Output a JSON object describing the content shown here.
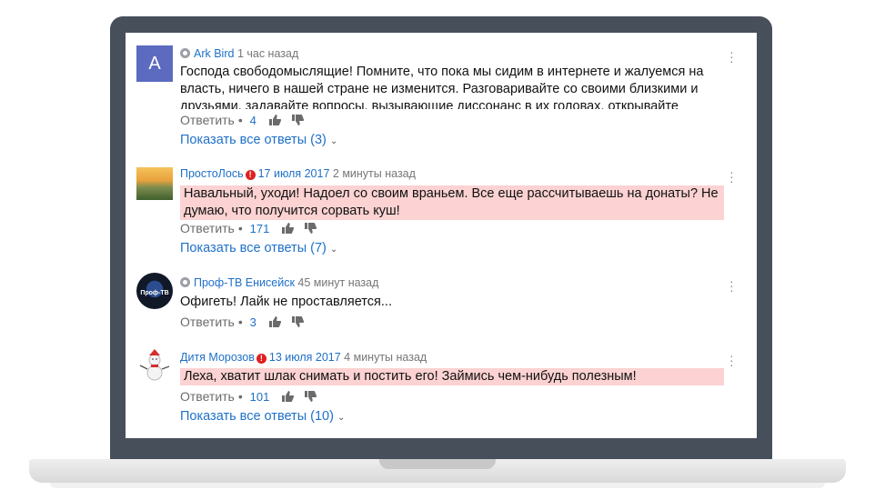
{
  "comments": [
    {
      "avatar_letter": "A",
      "author": "Ark Bird",
      "time": "1 час назад",
      "text": "Господа свободомыслящие! Помните, что пока мы сидим в интернете и жалуемся на власть, ничего в нашей стране не изменится. Разговаривайте со своими близкими и друзьями, задавайте вопросы, вызывающие диссонанс в их головах, открывайте",
      "reply_label": "Ответить",
      "likes": "4",
      "show_replies": "Показать все ответы (3)"
    },
    {
      "author": "ПростоЛось",
      "date": "17 июля 2017",
      "time": "2 минуты назад",
      "text": "Навальный, уходи! Надоел со своим враньем. Все еще рассчитываешь на донаты? Не думаю, что получится сорвать куш!",
      "reply_label": "Ответить",
      "likes": "171",
      "show_replies": "Показать все ответы (7)"
    },
    {
      "avatar_text": "Проф-ТВ",
      "author": "Проф-ТВ Енисейск",
      "time": "45 минут назад",
      "text": "Офигеть! Лайк не проставляется...",
      "reply_label": "Ответить",
      "likes": "3"
    },
    {
      "author": "Дитя Морозов",
      "date": "13 июля 2017",
      "time": "4 минуты назад",
      "text": "Леха, хватит шлак снимать и постить его! Займись чем-нибудь полезным!",
      "reply_label": "Ответить",
      "likes": "101",
      "show_replies": "Показать все ответы (10)"
    }
  ],
  "colors": {
    "link": "#1e70c8",
    "highlight": "#fcd2d2",
    "frame": "#474f5b",
    "avatar_a": "#5c6bc0",
    "warning": "#e02020"
  },
  "icons": {
    "channel": "channel-badge-icon",
    "warning": "exclamation-icon",
    "like": "thumbs-up-icon",
    "dislike": "thumbs-down-icon",
    "menu": "more-vert-icon",
    "expand": "chevron-down-icon"
  }
}
